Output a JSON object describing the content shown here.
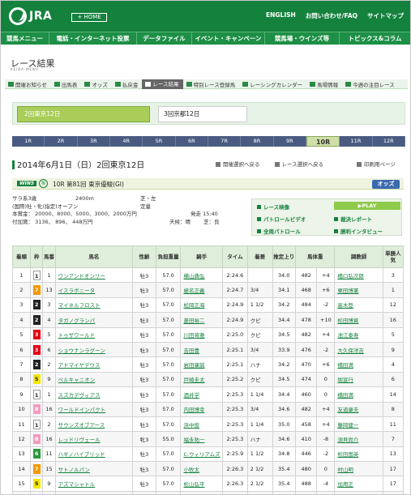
{
  "header": {
    "brand": "JRA",
    "home": "+ HOME",
    "links": [
      "ENGLISH",
      "お問い合わせ/FAQ",
      "サイトマップ"
    ]
  },
  "gnav": [
    "競馬メニュー",
    "電話・インターネット投票",
    "データファイル",
    "イベント・キャンペーン",
    "競馬場・ウインズ等",
    "トピックス&コラム"
  ],
  "page": {
    "title": "レース結果",
    "subtitle": "KEIBA MENU"
  },
  "subnav": [
    "開催お知らせ",
    "出馬表",
    "オッズ",
    "払戻金",
    "レース結果",
    "特別レース登録馬",
    "レーシングカレンダー",
    "馬場情報",
    "今週の注目レース"
  ],
  "courses": [
    "2回東京12日",
    "3回京都12日"
  ],
  "races": [
    "1R",
    "2R",
    "3R",
    "4R",
    "5R",
    "6R",
    "7R",
    "8R",
    "9R",
    "10R",
    "11R",
    "12R"
  ],
  "selected_race": "10R",
  "date": "2014年6月1日（日）2回東京12日",
  "nav": {
    "prev": "開催選択へ戻る",
    "next": "レース選択へ戻る",
    "print": "印刷用ページ"
  },
  "race": {
    "win5": "WIN5",
    "number": "⑤",
    "name": "10R 第81回 東京優駿(GI)",
    "odds": "オッズ"
  },
  "info": {
    "cls": "サラ系3歳",
    "dist": "2400m",
    "track": "芝・左",
    "cond1": "(国際)牡・牝(指定)オープン",
    "cond2": "定量",
    "prize": "本賞金： 20000、8000、5000、3000、2000万円",
    "start": "発走 15:40",
    "addprize": "付加賞： 3136、 896、 448万円",
    "weather": "天候：晴",
    "ground": "芝：良"
  },
  "media": {
    "video": "レース映像",
    "play": "▶PLAY",
    "patrol": "パトロールビデオ",
    "saiketsu": "裁決レポート",
    "wholepatrol": "全周パトロール",
    "interview": "勝利インタビュー"
  },
  "table": {
    "headers": [
      "着順",
      "枠",
      "馬番",
      "馬名",
      "性齢",
      "負担重量",
      "騎手",
      "タイム",
      "着差",
      "推定上り",
      "馬体重",
      "",
      "調教師",
      "単勝人気"
    ],
    "rows": [
      [
        "1",
        "1",
        "1",
        "ワンアンドオンリー",
        "牡3",
        "57.0",
        "横山典弘",
        "2:24.6",
        "",
        "34.0",
        "482",
        "+4",
        "橋口弘次郎",
        "3"
      ],
      [
        "2",
        "7",
        "13",
        "イスラボニータ",
        "牡3",
        "57.0",
        "蛯名正義",
        "2:24.7",
        "3/4",
        "34.1",
        "468",
        "+6",
        "栗田博憲",
        "1"
      ],
      [
        "3",
        "2",
        "3",
        "マイネルフロスト",
        "牡3",
        "57.0",
        "松岡正海",
        "2:24.9",
        "1 1/2",
        "34.2",
        "484",
        "-2",
        "高木登",
        "12"
      ],
      [
        "4",
        "2",
        "4",
        "タガノグランパ",
        "牡3",
        "57.0",
        "菱田裕二",
        "2:24.9",
        "クビ",
        "34.4",
        "478",
        "+10",
        "松田博資",
        "16"
      ],
      [
        "5",
        "3",
        "5",
        "トゥザワールド",
        "牡3",
        "57.0",
        "川田将雅",
        "2:25.0",
        "クビ",
        "34.5",
        "482",
        "+4",
        "池江泰寿",
        "5"
      ],
      [
        "6",
        "3",
        "6",
        "ショウナンラグーン",
        "牡3",
        "57.0",
        "吉田豊",
        "2:25.1",
        "3/4",
        "33.9",
        "476",
        "-2",
        "大久保洋吉",
        "9"
      ],
      [
        "7",
        "2",
        "2",
        "アドマイヤデウス",
        "牡3",
        "57.0",
        "岩田康誠",
        "2:25.1",
        "ハナ",
        "34.2",
        "470",
        "+6",
        "橋田満",
        "4"
      ],
      [
        "8",
        "5",
        "9",
        "ベルキャニオン",
        "牡3",
        "57.0",
        "戸崎圭太",
        "2:25.2",
        "クビ",
        "34.5",
        "474",
        "0",
        "堀宣行",
        "6"
      ],
      [
        "9",
        "1",
        "1",
        "スズカデヴィアス",
        "牡3",
        "57.0",
        "酒井学",
        "2:25.3",
        "1 1/4",
        "34.4",
        "460",
        "0",
        "橋田満",
        "14"
      ],
      [
        "10",
        "8",
        "16",
        "ワールドインパクト",
        "牡3",
        "57.0",
        "内田博幸",
        "2:25.3",
        "3/4",
        "34.6",
        "482",
        "+4",
        "友道康夫",
        "8"
      ],
      [
        "11",
        "1",
        "2",
        "サウンズオブアース",
        "牡3",
        "57.0",
        "浜中俊",
        "2:25.3",
        "1 1/4",
        "35.0",
        "458",
        "+4",
        "藤岡健一",
        "11"
      ],
      [
        "12",
        "8",
        "16",
        "レッドリヴェール",
        "牝3",
        "55.0",
        "福永祐一",
        "2:25.3",
        "ハナ",
        "34.6",
        "410",
        "-8",
        "須貝尚介",
        "7"
      ],
      [
        "13",
        "6",
        "11",
        "ハギノハイブリッド",
        "牡3",
        "57.0",
        "C.ウィリアムズ",
        "2:25.9",
        "1 1/2",
        "34.8",
        "446",
        "-2",
        "松田国英",
        "13"
      ],
      [
        "14",
        "7",
        "15",
        "サトノルパン",
        "牡3",
        "57.0",
        "小牧太",
        "2:26.3",
        "2 1/2",
        "35.4",
        "480",
        "0",
        "村山明",
        "17"
      ],
      [
        "15",
        "5",
        "9",
        "アズマシャトル",
        "牡3",
        "57.0",
        "松山弘平",
        "2:26.3",
        "2 1/2",
        "35.4",
        "488",
        "-4",
        "加用正",
        "17"
      ],
      [
        "16",
        "7",
        "17",
        "トーセンスターダム",
        "牡3",
        "57.0",
        "武豊",
        "2:28.1",
        "9",
        "37.9",
        "482",
        "-4",
        "池江泰寿",
        "2"
      ]
    ]
  },
  "colors": {
    "brand": "#14823d",
    "waku": [
      "#ffffff",
      "#222222",
      "#e60012",
      "#1e5fd0",
      "#f5e700",
      "#2a9a3a",
      "#f39800",
      "#f19cbf"
    ]
  }
}
